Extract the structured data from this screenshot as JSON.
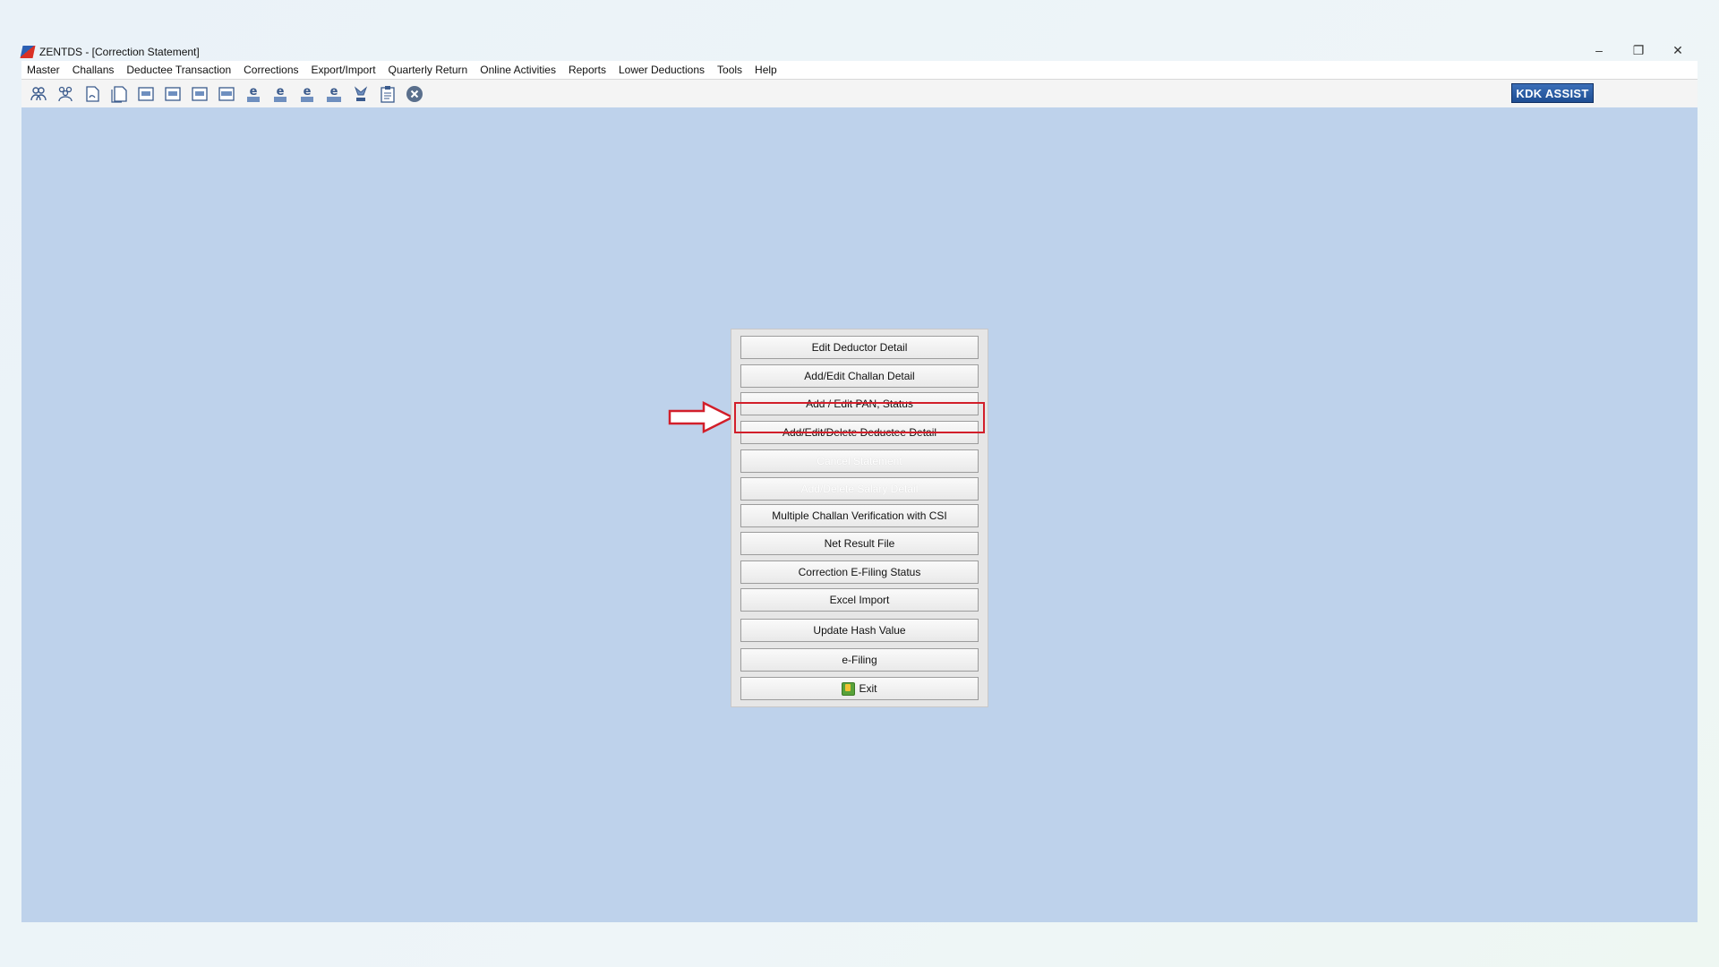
{
  "window": {
    "title": "ZENTDS - [Correction Statement]",
    "controls": {
      "minimize": "–",
      "restore": "❐",
      "close": "✕"
    }
  },
  "menubar": {
    "items": [
      {
        "label": "Master"
      },
      {
        "label": "Challans"
      },
      {
        "label": "Deductee Transaction"
      },
      {
        "label": "Corrections"
      },
      {
        "label": "Export/Import"
      },
      {
        "label": "Quarterly Return"
      },
      {
        "label": "Online Activities"
      },
      {
        "label": "Reports"
      },
      {
        "label": "Lower Deductions"
      },
      {
        "label": "Tools"
      },
      {
        "label": "Help"
      }
    ]
  },
  "toolbar": {
    "icons": [
      "users-icon",
      "users-group-icon",
      "document-icon",
      "document-copy-icon",
      "form-24q-icon",
      "form-26q-icon",
      "form-27q-icon",
      "form-27eq-icon",
      "e-24q-icon",
      "e-26q-icon",
      "e-27q-icon",
      "e-27eq-icon",
      "tds-icon",
      "clipboard-icon",
      "close-circle-icon"
    ],
    "kdk_assist": "KDK ASSIST"
  },
  "panel": {
    "buttons": [
      {
        "label": "Edit Deductor Detail",
        "enabled": true
      },
      {
        "label": "Add/Edit Challan Detail",
        "enabled": true
      },
      {
        "label": "Add / Edit PAN, Status",
        "enabled": true
      },
      {
        "label": "Add/Edit/Delete Deductee Detail",
        "enabled": true,
        "highlighted": true
      },
      {
        "label": "Cancel Statement",
        "enabled": false
      },
      {
        "label": "Add/Delete Salary Detail",
        "enabled": false
      },
      {
        "label": "Multiple Challan Verification with CSI",
        "enabled": true
      },
      {
        "label": "Net Result File",
        "enabled": true
      },
      {
        "label": "Correction E-Filing Status",
        "enabled": true
      },
      {
        "label": "Excel Import",
        "enabled": true
      },
      {
        "label": "Update Hash Value",
        "enabled": true
      },
      {
        "label": "e-Filing",
        "enabled": true
      },
      {
        "label": "Exit",
        "enabled": true
      }
    ]
  },
  "annotation": {
    "arrow_color": "#d21f2a",
    "highlight_color": "#d21f2a"
  }
}
